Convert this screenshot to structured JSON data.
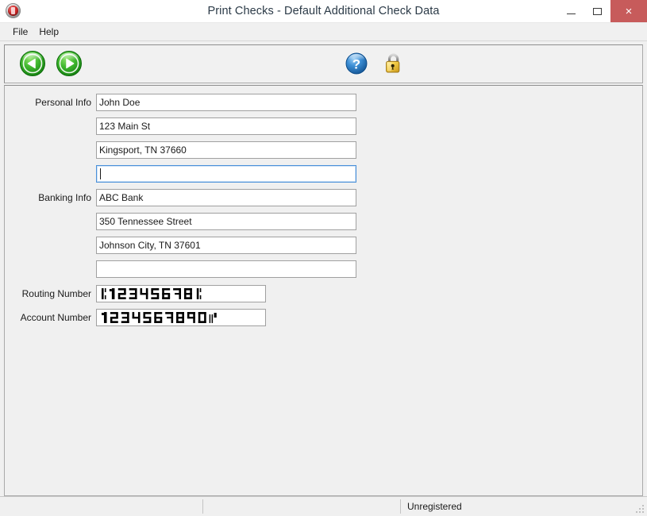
{
  "window": {
    "title": "Print Checks - Default Additional Check Data",
    "app_icon": "print-checks-app-icon",
    "controls": {
      "minimize": "minimize-icon",
      "maximize": "maximize-icon",
      "close": "×"
    }
  },
  "menubar": {
    "items": [
      {
        "label": "File"
      },
      {
        "label": "Help"
      }
    ]
  },
  "toolbar": {
    "buttons": [
      {
        "name": "previous-record-button",
        "icon": "green-left-arrow-icon",
        "label": ""
      },
      {
        "name": "next-record-button",
        "icon": "green-right-arrow-icon",
        "label": ""
      },
      {
        "name": "help-button",
        "icon": "blue-question-mark-icon",
        "label": ""
      },
      {
        "name": "unlock-button",
        "icon": "yellow-padlock-icon",
        "label": ""
      }
    ]
  },
  "form": {
    "personal_info": {
      "label": "Personal Info",
      "fields": [
        {
          "name": "personal-name-input",
          "value": "John Doe",
          "placeholder": "",
          "focused": false
        },
        {
          "name": "personal-address-input",
          "value": "123 Main St",
          "placeholder": "",
          "focused": false
        },
        {
          "name": "personal-city-state-zip-input",
          "value": "Kingsport, TN 37660",
          "placeholder": "",
          "focused": false
        },
        {
          "name": "personal-extra-line-input",
          "value": "",
          "placeholder": "",
          "focused": true
        }
      ]
    },
    "banking_info": {
      "label": "Banking Info",
      "fields": [
        {
          "name": "bank-name-input",
          "value": "ABC Bank",
          "placeholder": "",
          "focused": false
        },
        {
          "name": "bank-address-input",
          "value": "350 Tennessee Street",
          "placeholder": "",
          "focused": false
        },
        {
          "name": "bank-city-state-zip-input",
          "value": "Johnson City, TN 37601",
          "placeholder": "",
          "focused": false
        },
        {
          "name": "bank-extra-line-input",
          "value": "",
          "placeholder": "",
          "focused": false
        }
      ]
    },
    "routing_number": {
      "label": "Routing Number",
      "value": "⑆ 12345678 ⑆",
      "digits": "12345678",
      "prefix_symbol": "transit",
      "suffix_symbol": "transit"
    },
    "account_number": {
      "label": "Account Number",
      "value": "1234567890 ⑈",
      "digits": "1234567890",
      "prefix_symbol": "",
      "suffix_symbol": "on-us"
    }
  },
  "statusbar": {
    "panes": [
      {
        "name": "status-pane-left",
        "text": ""
      },
      {
        "name": "status-pane-middle",
        "text": ""
      },
      {
        "name": "status-pane-registration",
        "text": "Unregistered"
      }
    ]
  },
  "colors": {
    "title_text": "#2b3a47",
    "close_button": "#c75b5b",
    "nav_green": "#2aa02a",
    "help_blue": "#1d6fc0",
    "lock_gold": "#e8c547",
    "focus_border": "#4a90d9",
    "window_bg": "#f0f0f0"
  }
}
